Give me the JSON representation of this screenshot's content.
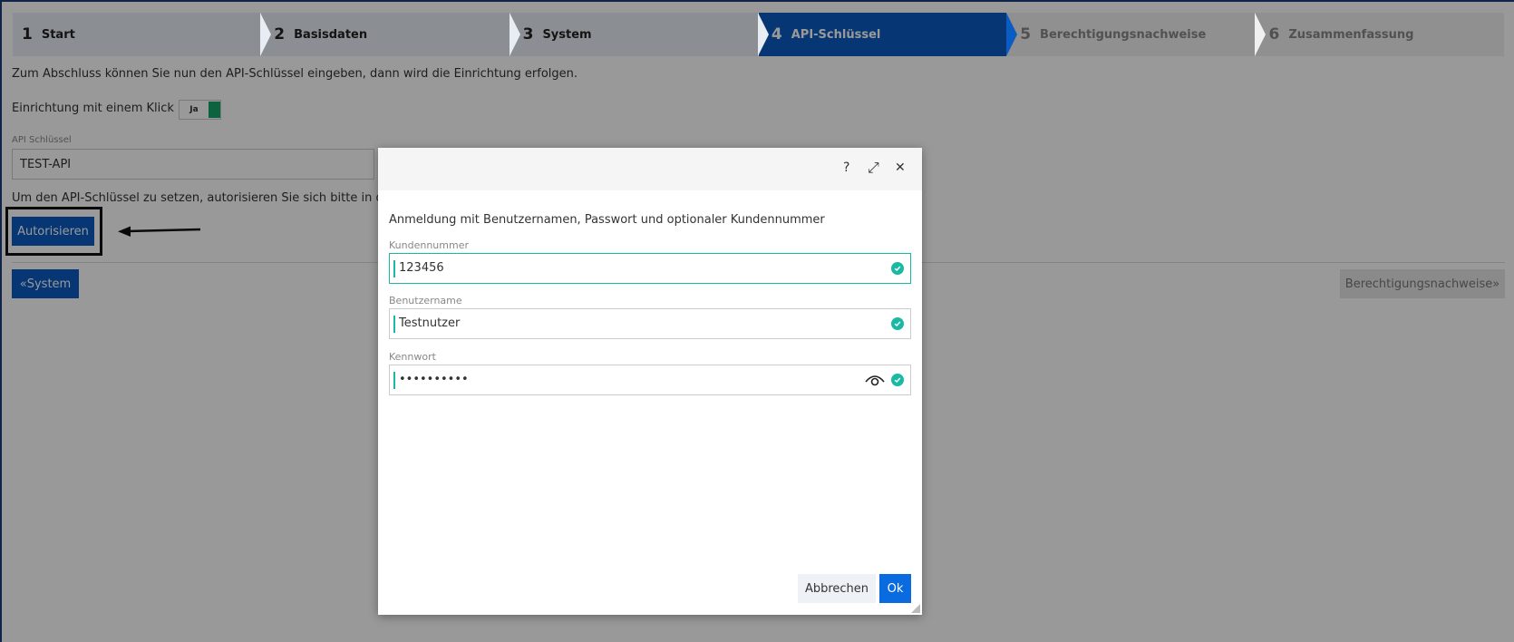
{
  "stepper": [
    {
      "num": "1",
      "label": "Start",
      "state": "done"
    },
    {
      "num": "2",
      "label": "Basisdaten",
      "state": "done"
    },
    {
      "num": "3",
      "label": "System",
      "state": "done"
    },
    {
      "num": "4",
      "label": "API-Schlüssel",
      "state": "active"
    },
    {
      "num": "5",
      "label": "Berechtigungsnachweise",
      "state": "future"
    },
    {
      "num": "6",
      "label": "Zusammenfassung",
      "state": "future"
    }
  ],
  "page": {
    "intro": "Zum Abschluss können Sie nun den API-Schlüssel eingeben, dann wird die Einrichtung erfolgen.",
    "oneclick_label": "Einrichtung mit einem Klick",
    "toggle_text": "Ja",
    "api_label": "API Schlüssel",
    "api_value": "TEST-API",
    "auth_note": "Um den API-Schlüssel zu setzen, autorisieren Sie sich bitte in dem g",
    "authorize_button": "Autorisieren",
    "back_button": "«System",
    "next_button": "Berechtigungsnachweise»"
  },
  "modal": {
    "help_icon": "?",
    "expand_icon": "⤢",
    "close_icon": "✕",
    "title": "Anmeldung mit Benutzernamen, Passwort und optionaler Kundennummer",
    "fields": [
      {
        "label": "Kundennummer",
        "value": "123456"
      },
      {
        "label": "Benutzername",
        "value": "Testnutzer"
      },
      {
        "label": "Kennwort",
        "value": "••••••••••"
      }
    ],
    "cancel_button": "Abbrechen",
    "ok_button": "Ok"
  },
  "colors": {
    "primary": "#0a5cc2",
    "valid": "#1ab9a3",
    "toggle_on": "#1aa36b"
  }
}
